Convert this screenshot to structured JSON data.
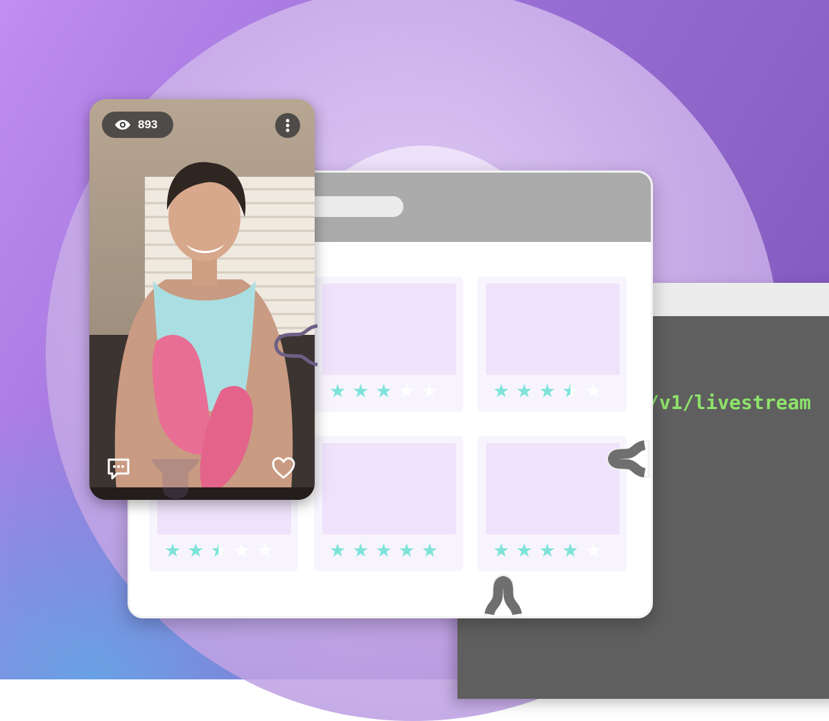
{
  "video_card": {
    "view_count": "893",
    "icons": {
      "views": "eye-icon",
      "more": "more-vertical-icon",
      "comment": "comment-icon",
      "like": "heart-icon"
    }
  },
  "terminal": {
    "code_fragment": "/v1/livestream"
  },
  "product_grid": {
    "star_color": "#7ee3d8",
    "cards": [
      {
        "rating": 3
      },
      {
        "rating": 3.5
      },
      {
        "rating": 2.5
      },
      {
        "rating": 5
      },
      {
        "rating": 4
      }
    ]
  },
  "colors": {
    "background_purple": "#9a6fd6",
    "terminal_bg": "#5f5f5f",
    "terminal_text": "#8ee36a",
    "browser_header": "#ababab",
    "card_placeholder": "#efe2fb"
  }
}
